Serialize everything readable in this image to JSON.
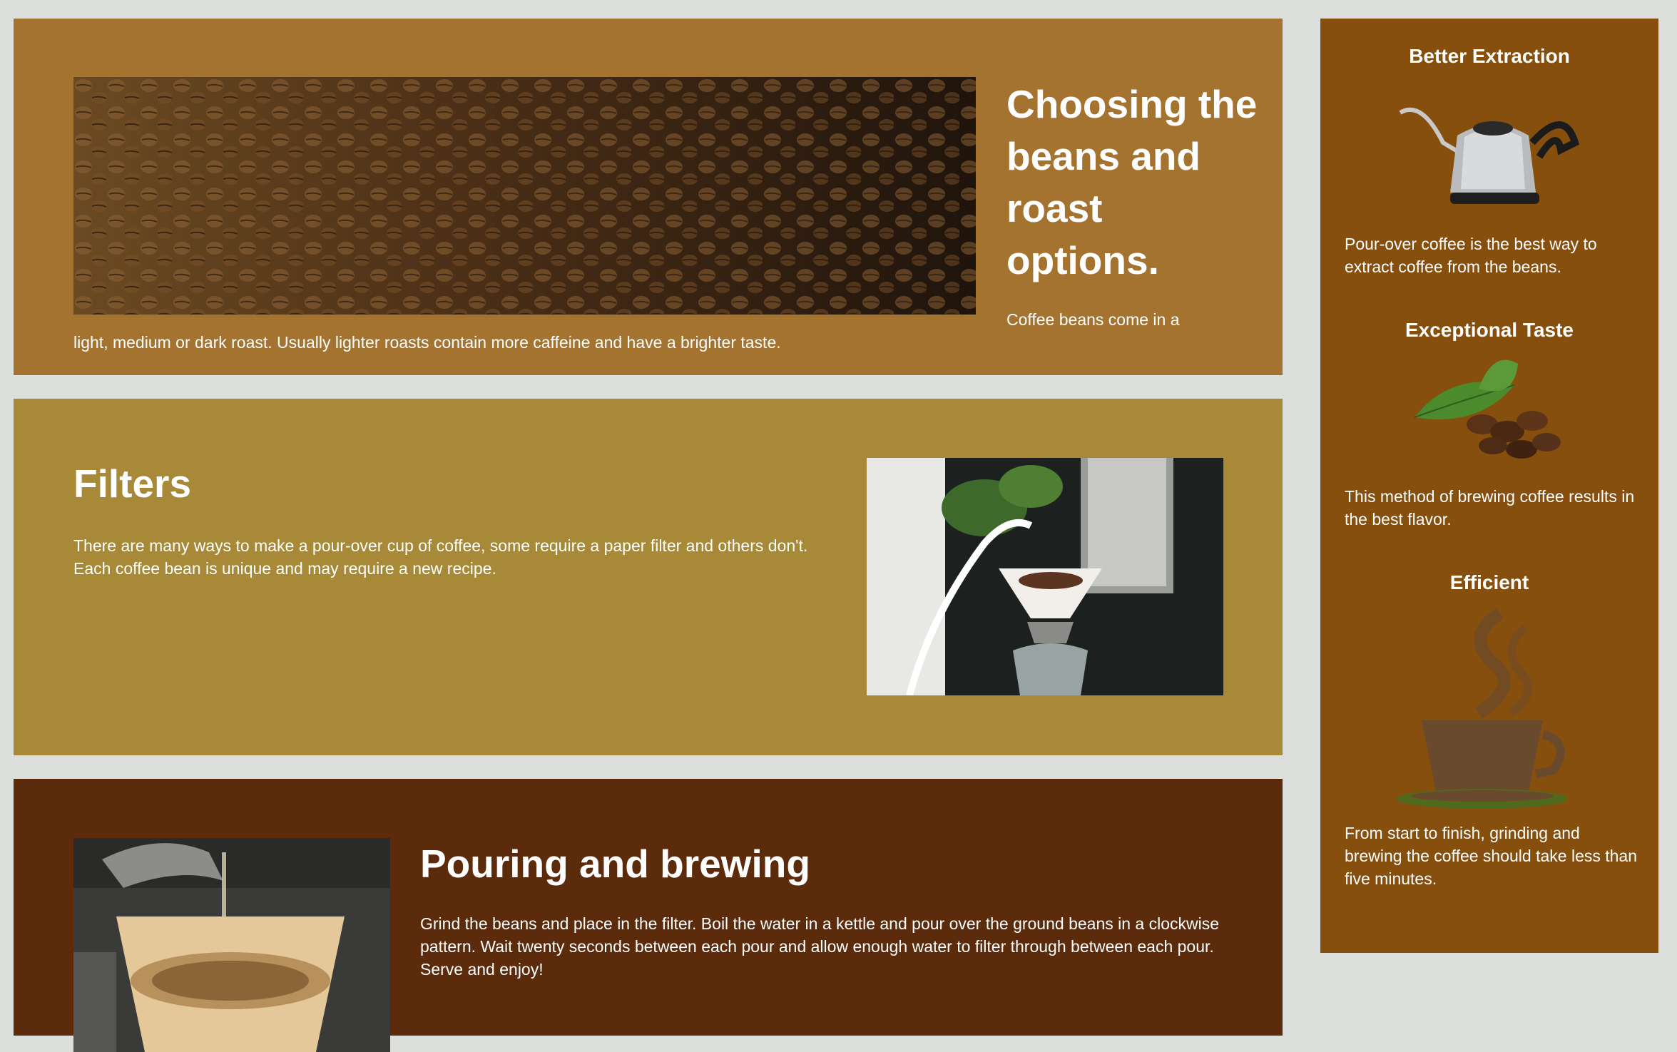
{
  "sections": {
    "beans": {
      "title": "Choosing the beans and roast options.",
      "text_line1": "Coffee beans come in a",
      "text_line2": "light, medium or dark roast. Usually lighter roasts contain more caffeine and have a brighter taste."
    },
    "filters": {
      "title": "Filters",
      "text": "There are many ways to make a pour-over cup of coffee, some require a paper filter and others don't. Each coffee bean is unique and may require a new recipe."
    },
    "pouring": {
      "title": "Pouring and brewing",
      "text": "Grind the beans and place in the filter. Boil the water in a kettle and pour over the ground beans in a clockwise pattern. Wait twenty seconds between each pour and allow enough water to filter through between each pour. Serve and enjoy!"
    }
  },
  "sidebar": {
    "items": [
      {
        "heading": "Better Extraction",
        "text": "Pour-over coffee is the best way to extract coffee from the beans.",
        "icon": "kettle-icon"
      },
      {
        "heading": "Exceptional Taste",
        "text": "This method of brewing coffee results in the best flavor.",
        "icon": "coffee-beans-leaf-icon"
      },
      {
        "heading": "Efficient",
        "text": "From start to finish, grinding and brewing the coffee should take less than five minutes.",
        "icon": "steaming-cup-icon"
      }
    ]
  },
  "colors": {
    "page_bg": "#dcdfdb",
    "section_beans": "#a57330",
    "section_filters": "#a78937",
    "section_pouring": "#5b2b0c",
    "sidebar": "#864f0e"
  }
}
